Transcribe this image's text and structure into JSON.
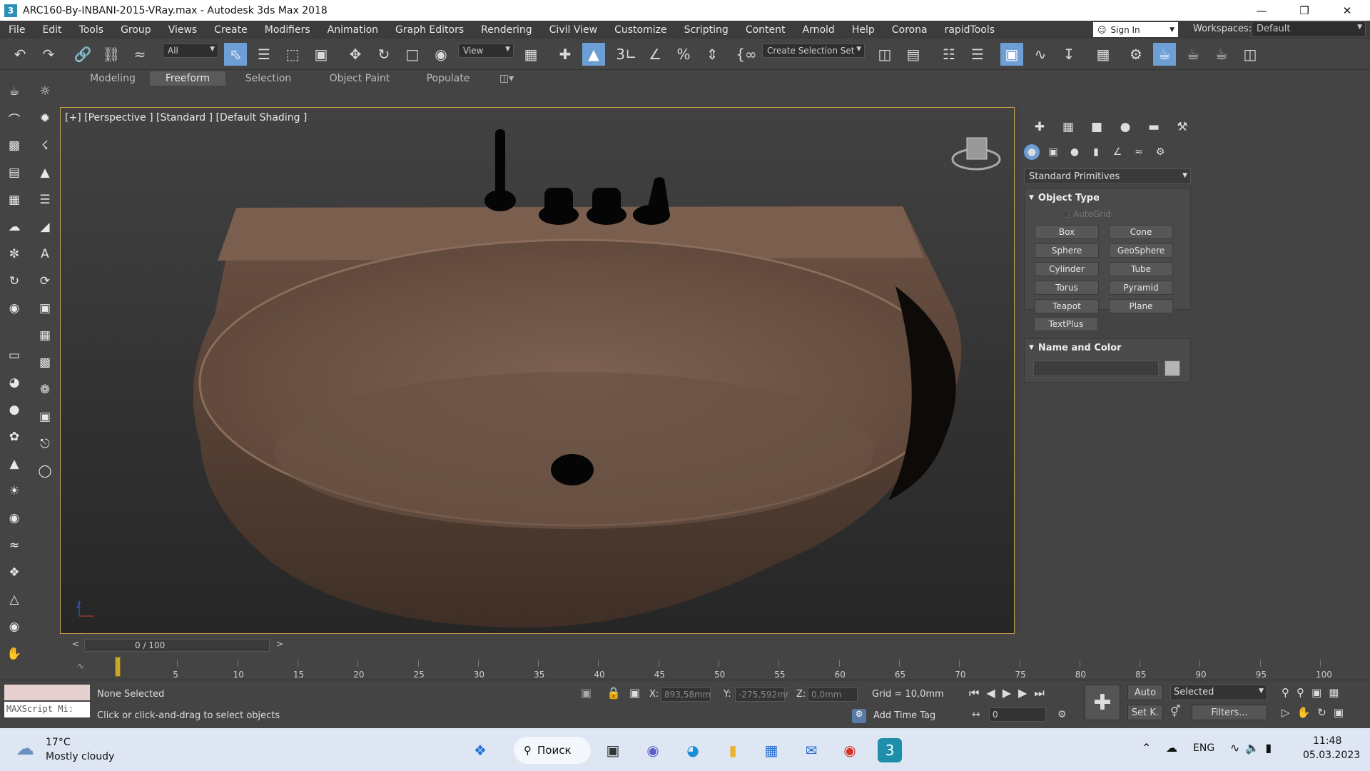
{
  "window": {
    "title": "ARC160-By-INBANI-2015-VRay.max - Autodesk 3ds Max 2018",
    "app_icon": "3"
  },
  "menubar": {
    "items": [
      "File",
      "Edit",
      "Tools",
      "Group",
      "Views",
      "Create",
      "Modifiers",
      "Animation",
      "Graph Editors",
      "Rendering",
      "Civil View",
      "Customize",
      "Scripting",
      "Content",
      "Arnold",
      "Help",
      "Corona",
      "rapidTools"
    ]
  },
  "account": {
    "sign_in": "Sign In",
    "workspaces_label": "Workspaces:",
    "workspace_value": "Default"
  },
  "toolbar": {
    "filter_value": "All",
    "ref_coord_value": "View",
    "selection_set_placeholder": "Create Selection Set"
  },
  "ribbon": {
    "tabs": [
      "Modeling",
      "Freeform",
      "Selection",
      "Object Paint",
      "Populate"
    ],
    "active": "Freeform"
  },
  "viewport": {
    "label": "[+] [Perspective ] [Standard ] [Default Shading ]"
  },
  "command_panel": {
    "category_value": "Standard Primitives",
    "object_type": {
      "title": "Object Type",
      "autogrid": "AutoGrid",
      "buttons": [
        "Box",
        "Cone",
        "Sphere",
        "GeoSphere",
        "Cylinder",
        "Tube",
        "Torus",
        "Pyramid",
        "Teapot",
        "Plane",
        "TextPlus"
      ]
    },
    "name_color": {
      "title": "Name and Color",
      "swatch_color": "#b4b4b4"
    }
  },
  "timeline": {
    "frame_display": "0 / 100",
    "ticks": [
      0,
      5,
      10,
      15,
      20,
      25,
      30,
      35,
      40,
      45,
      50,
      55,
      60,
      65,
      70,
      75,
      80,
      85,
      90,
      95,
      100
    ]
  },
  "status": {
    "maxscript": "MAXScript Mi:",
    "selection": "None Selected",
    "prompt": "Click or click-and-drag to select objects",
    "x_label": "X:",
    "x_value": "893,58mm",
    "y_label": "Y:",
    "y_value": "-275,592mr",
    "z_label": "Z:",
    "z_value": "0,0mm",
    "grid": "Grid = 10,0mm",
    "add_time_tag": "Add Time Tag",
    "auto_key": "Auto",
    "set_key": "Set K.",
    "key_filter_value": "Selected",
    "filters": "Filters...",
    "frame_spinner": "0"
  },
  "taskbar": {
    "weather_temp": "17°C",
    "weather_desc": "Mostly cloudy",
    "search": "Поиск",
    "lang": "ENG",
    "time": "11:48",
    "date": "05.03.2023"
  },
  "colors": {
    "sink": "#7a6050",
    "viewport_border": "#c8a04a",
    "active_tool": "#6d9fd6"
  }
}
